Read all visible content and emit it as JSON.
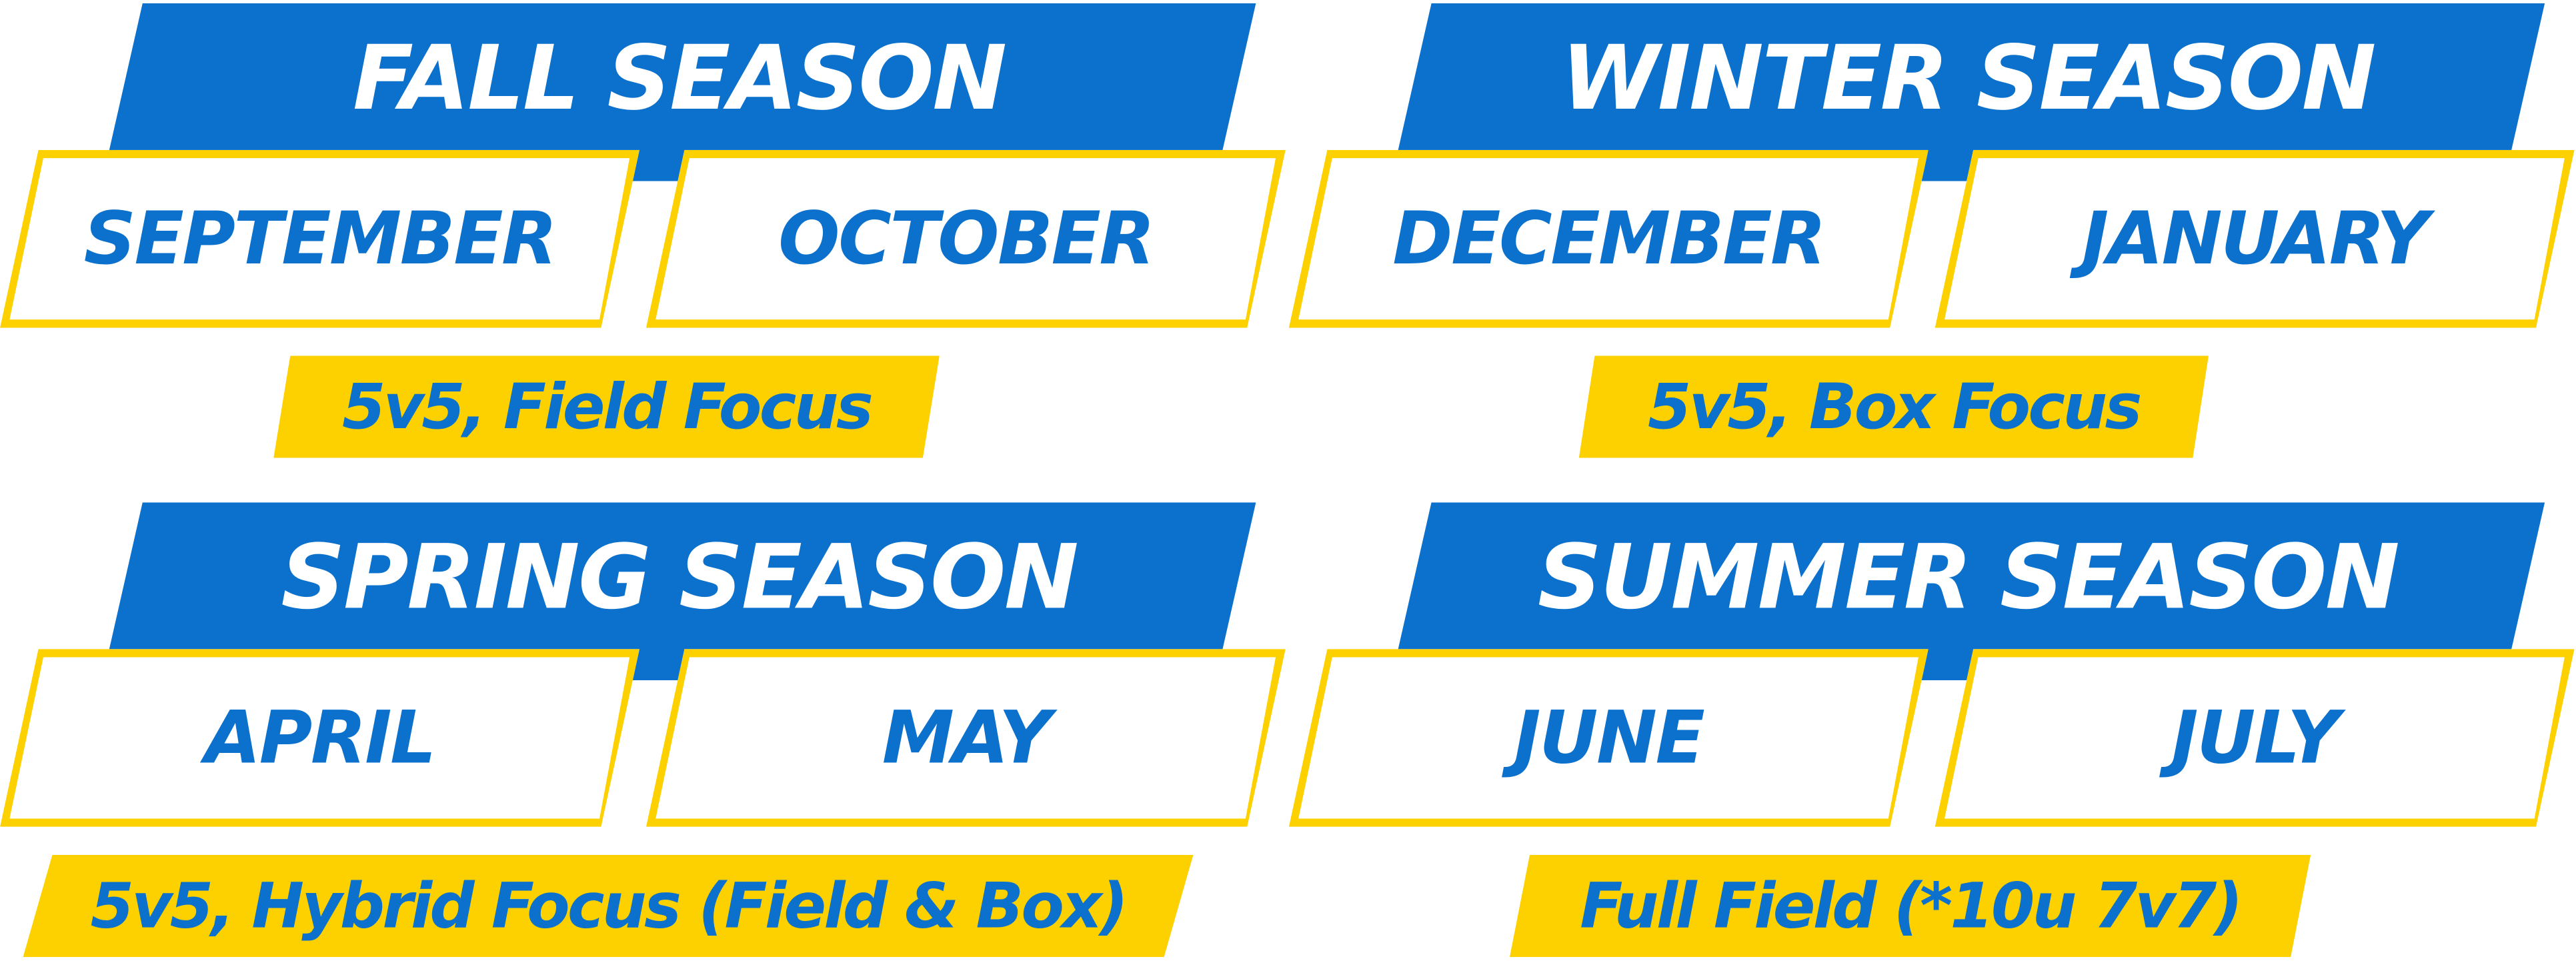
{
  "seasons": [
    {
      "title": "FALL SEASON",
      "months": [
        "SEPTEMBER",
        "OCTOBER"
      ],
      "focus": "5v5, Field Focus"
    },
    {
      "title": "WINTER SEASON",
      "months": [
        "DECEMBER",
        "JANUARY"
      ],
      "focus": "5v5, Box Focus"
    },
    {
      "title": "SPRING SEASON",
      "months": [
        "APRIL",
        "MAY"
      ],
      "focus": "5v5, Hybrid Focus (Field & Box)"
    },
    {
      "title": "SUMMER SEASON",
      "months": [
        "JUNE",
        "JULY"
      ],
      "focus": "Full Field (*10u 7v7)"
    }
  ],
  "colors": {
    "header_blue": "#0c71cc",
    "accent_yellow": "#fdd000",
    "text_on_header": "#ffffff",
    "background": "#ffffff"
  }
}
